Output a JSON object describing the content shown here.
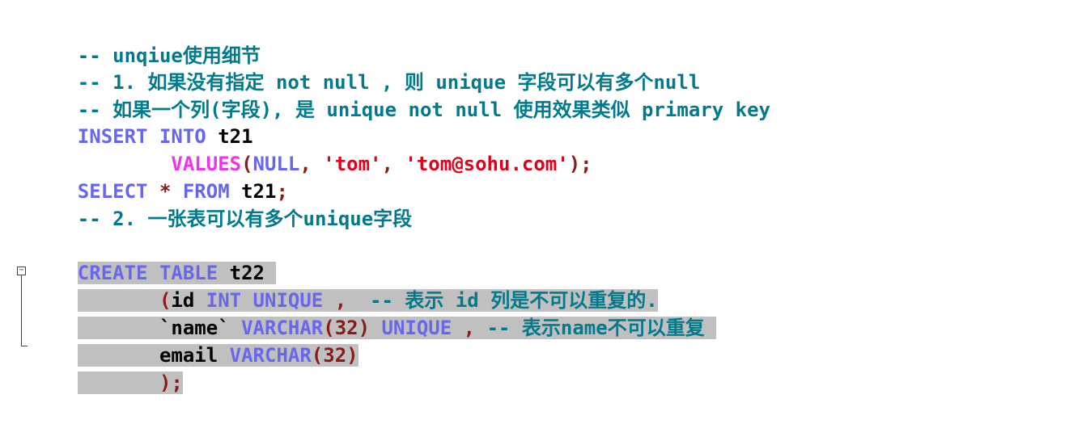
{
  "lines": {
    "l1": "-- unqiue使用细节",
    "l2": "-- 1. 如果没有指定 not null , 则 unique 字段可以有多个null",
    "l3": "-- 如果一个列(字段), 是 unique not null 使用效果类似 primary key",
    "l4_kw": "INSERT INTO",
    "l4_id": " t21",
    "l5_indent": "        ",
    "l5_fn": "VALUES",
    "l5_p1": "(",
    "l5_null": "NULL",
    "l5_c1": ", ",
    "l5_s1": "'tom'",
    "l5_c2": ", ",
    "l5_s2": "'tom@sohu.com'",
    "l5_end": ");",
    "l6_kw1": "SELECT",
    "l6_star": " * ",
    "l6_kw2": "FROM",
    "l6_id": " t21",
    "l6_end": ";",
    "l7": "-- 2. 一张表可以有多个unique字段",
    "l8_kw": "CREATE TABLE",
    "l8_id": " t22 ",
    "l9_indent": "       ",
    "l9_p": "(",
    "l9_id": "id",
    "l9_kw": " INT UNIQUE ",
    "l9_c": ",  ",
    "l9_comment": "-- 表示 id 列是不可以重复的.",
    "l10_indent": "       ",
    "l10_id": "`name`",
    "l10_kw": " VARCHAR",
    "l10_p": "(32)",
    "l10_kw2": " UNIQUE ",
    "l10_c": ", ",
    "l10_comment": "-- 表示name不可以重复 ",
    "l11_indent": "       ",
    "l11_id": "email",
    "l11_kw": " VARCHAR",
    "l11_p": "(32)",
    "l12_indent": "       ",
    "l12_end": ");"
  },
  "colors": {
    "comment": "#007a8c",
    "keyword": "#6666ee",
    "function": "#ee33ee",
    "string": "#e0001c",
    "punctuation": "#8b1a1a",
    "selection": "#c0c0c0"
  },
  "icons": {
    "fold": "fold-collapse-icon"
  }
}
